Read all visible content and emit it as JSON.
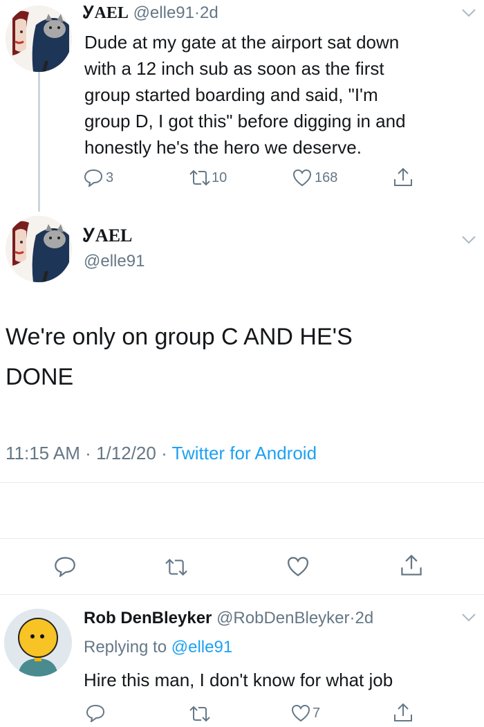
{
  "tweet1": {
    "name": "ᎩAEL",
    "handle": "@elle91",
    "sep": "·",
    "time": "2d",
    "lines": [
      "Dude at my gate at the airport sat down",
      "with a 12 inch sub as soon as the first",
      "group started boarding and said, \"I'm",
      "group D, I got this\" before digging in and",
      "honestly he's the hero we deserve."
    ],
    "replies": "3",
    "retweets": "10",
    "likes": "168"
  },
  "main": {
    "name": "ᎩAEL",
    "handle": "@elle91",
    "lines": [
      "We're only on group C AND HE'S",
      "DONE"
    ],
    "time": "11:15 AM",
    "sep1": "·",
    "date": "1/12/20",
    "sep2": "·",
    "source": "Twitter for Android"
  },
  "reply": {
    "name": "Rob DenBleyker",
    "handle": "@RobDenBleyker",
    "sep": "·",
    "time": "2d",
    "replying_prefix": "Replying to",
    "replying_to": "@elle91",
    "text": "Hire this man, I don't know for what job",
    "likes": "7"
  },
  "colors": {
    "text": "#14171a",
    "secondary": "#657786",
    "link": "#1da1f2",
    "divider": "#e6ecf0"
  },
  "icons": [
    "reply-icon",
    "retweet-icon",
    "like-icon",
    "share-icon",
    "chevron-down-icon"
  ]
}
